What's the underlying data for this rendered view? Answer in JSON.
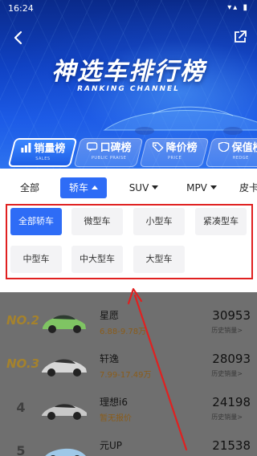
{
  "status_bar": {
    "time": "16:24",
    "icons_text": "▾▴ ▮"
  },
  "header": {
    "title": "神选车排行榜",
    "subtitle": "RANKING CHANNEL"
  },
  "rank_tabs": [
    {
      "label": "销量榜",
      "en": "SALES",
      "icon": "chart-icon",
      "active": true
    },
    {
      "label": "口碑榜",
      "en": "PUBLIC PRAISE",
      "icon": "speech-icon",
      "active": false
    },
    {
      "label": "降价榜",
      "en": "PRICE",
      "icon": "tag-icon",
      "active": false
    },
    {
      "label": "保值榜",
      "en": "HEDGE",
      "icon": "shield-icon",
      "active": false
    }
  ],
  "filters": [
    {
      "label": "全部",
      "dropdown": false,
      "active": false
    },
    {
      "label": "轿车",
      "dropdown": true,
      "active": true
    },
    {
      "label": "SUV",
      "dropdown": true,
      "active": false
    },
    {
      "label": "MPV",
      "dropdown": true,
      "active": false
    },
    {
      "label": "皮卡",
      "dropdown": false,
      "active": false
    }
  ],
  "sedan_types": [
    {
      "label": "全部轿车",
      "active": true
    },
    {
      "label": "微型车",
      "active": false
    },
    {
      "label": "小型车",
      "active": false
    },
    {
      "label": "紧凑型车",
      "active": false
    },
    {
      "label": "中型车",
      "active": false
    },
    {
      "label": "中大型车",
      "active": false
    },
    {
      "label": "大型车",
      "active": false
    }
  ],
  "ranking_list": [
    {
      "rank": "NO.2",
      "name": "星愿",
      "price": "6.88-9.78万",
      "sales": "30953",
      "sales_label": "历史销量>",
      "car_color": "#7fc463"
    },
    {
      "rank": "NO.3",
      "name": "轩逸",
      "price": "7.99-17.49万",
      "sales": "28093",
      "sales_label": "历史销量>",
      "car_color": "#d7d7d7"
    },
    {
      "rank": "4",
      "name": "理想i6",
      "price": "暂无报价",
      "sales": "24198",
      "sales_label": "历史销量>",
      "car_color": "#c8c8c8"
    },
    {
      "rank": "5",
      "name": "元UP",
      "price": "",
      "sales": "21538",
      "sales_label": "",
      "car_color": "#9ec8e8"
    }
  ],
  "colors": {
    "accent": "#2e6cf6",
    "annotation": "#e02020"
  }
}
